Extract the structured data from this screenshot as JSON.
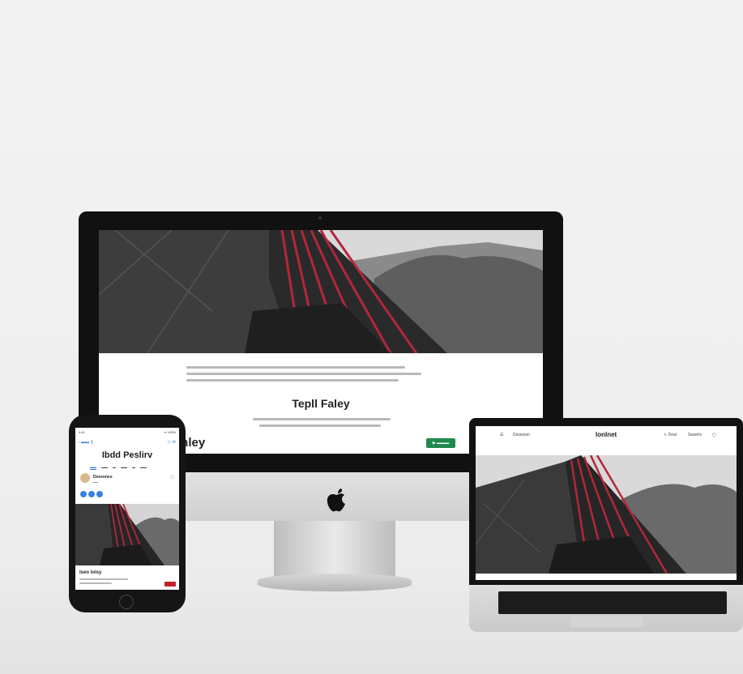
{
  "imac": {
    "title": "Tepll Faley",
    "brand": "inley",
    "button_label": "▶ ▬▬▬"
  },
  "phone": {
    "status_time": "9:41",
    "status_right": "▪▪ 100%",
    "nav_back": "‹ ▬▬ ❙",
    "nav_right": "▷ ✉",
    "title": "Ibdd Peslirv",
    "tabs": [
      "▬▬",
      "▬▬",
      "▬",
      "▬▬",
      "▬",
      "▬▬"
    ],
    "user_name": "Dessnnes",
    "user_sub": "▬▬",
    "close": "▢",
    "section_title": "Iseo loisy"
  },
  "laptop": {
    "menu": "☰",
    "nav_item": "Desesser",
    "logo": "lonlnet",
    "right_items": [
      "⇖ Dear",
      "Seavtrs",
      "▢"
    ]
  },
  "colors": {
    "accent_green": "#1f8a4c",
    "accent_red": "#c0222e",
    "accent_blue": "#3978d8"
  }
}
